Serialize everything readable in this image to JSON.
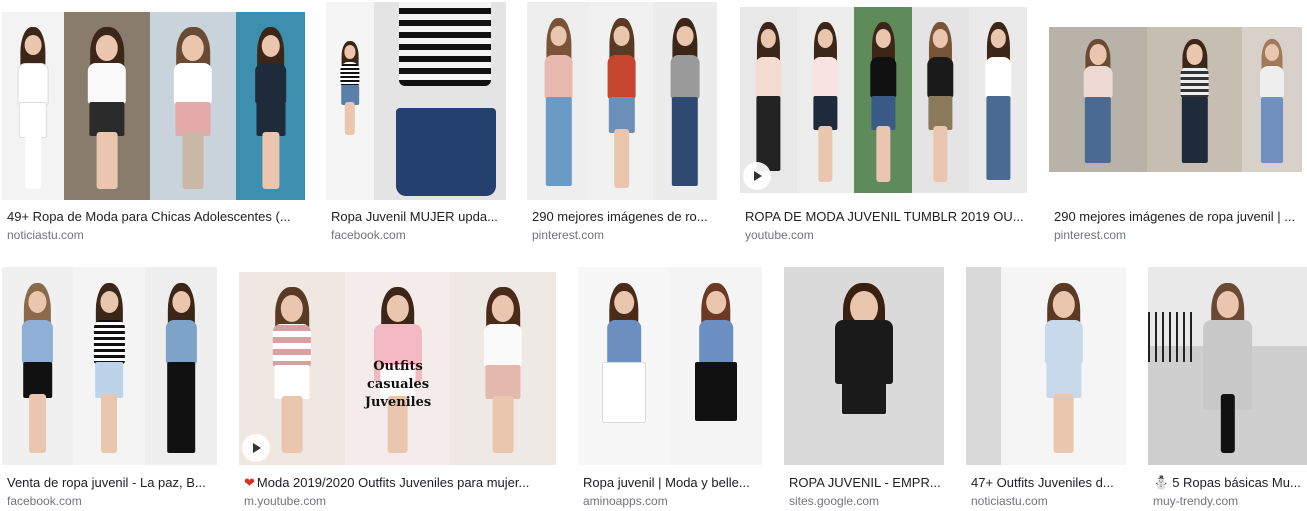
{
  "results": [
    {
      "title": "49+ Ropa de Moda para Chicas Adolescentes (...",
      "source": "noticiastu.com",
      "video": false
    },
    {
      "title": "Ropa Juvenil MUJER upda...",
      "source": "facebook.com",
      "video": false
    },
    {
      "title": "290 mejores imágenes de ro...",
      "source": "pinterest.com",
      "video": false
    },
    {
      "title": "ROPA DE MODA JUVENIL TUMBLR 2019 OU...",
      "source": "youtube.com",
      "video": true
    },
    {
      "title": "290 mejores imágenes de ropa juvenil | ...",
      "source": "pinterest.com",
      "video": false
    },
    {
      "title": "Venta de ropa juvenil - La paz, B...",
      "source": "facebook.com",
      "video": false
    },
    {
      "title": "Moda 2019/2020 Outfits Juveniles para mujer...",
      "source": "m.youtube.com",
      "video": true,
      "emoji": "❤"
    },
    {
      "title": "Ropa juvenil | Moda y belle...",
      "source": "aminoapps.com",
      "video": false
    },
    {
      "title": "ROPA JUVENIL - EMPR...",
      "source": "sites.google.com",
      "video": false
    },
    {
      "title": "47+ Outfits Juveniles d...",
      "source": "noticiastu.com",
      "video": false
    },
    {
      "title": "5 Ropas básicas Mu...",
      "source": "muy-trendy.com",
      "video": false,
      "emoji": "⛄"
    }
  ],
  "thumb_overlay_text": "Outfits casuales Juveniles",
  "colors": {
    "title": "#202124",
    "source": "#70757a"
  }
}
